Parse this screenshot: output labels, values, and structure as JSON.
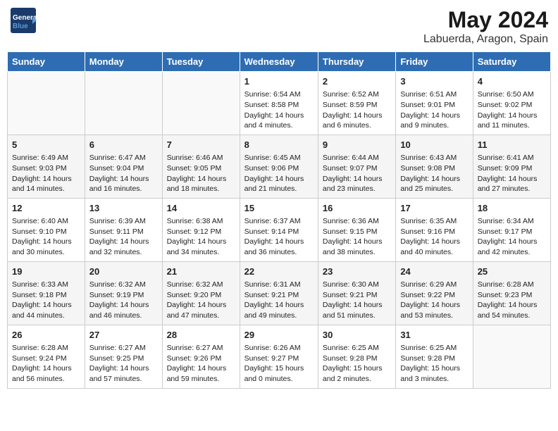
{
  "logo": {
    "line1": "General",
    "line2": "Blue"
  },
  "title": "May 2024",
  "subtitle": "Labuerda, Aragon, Spain",
  "days_header": [
    "Sunday",
    "Monday",
    "Tuesday",
    "Wednesday",
    "Thursday",
    "Friday",
    "Saturday"
  ],
  "weeks": [
    [
      {
        "day": "",
        "info": ""
      },
      {
        "day": "",
        "info": ""
      },
      {
        "day": "",
        "info": ""
      },
      {
        "day": "1",
        "info": "Sunrise: 6:54 AM\nSunset: 8:58 PM\nDaylight: 14 hours\nand 4 minutes."
      },
      {
        "day": "2",
        "info": "Sunrise: 6:52 AM\nSunset: 8:59 PM\nDaylight: 14 hours\nand 6 minutes."
      },
      {
        "day": "3",
        "info": "Sunrise: 6:51 AM\nSunset: 9:01 PM\nDaylight: 14 hours\nand 9 minutes."
      },
      {
        "day": "4",
        "info": "Sunrise: 6:50 AM\nSunset: 9:02 PM\nDaylight: 14 hours\nand 11 minutes."
      }
    ],
    [
      {
        "day": "5",
        "info": "Sunrise: 6:49 AM\nSunset: 9:03 PM\nDaylight: 14 hours\nand 14 minutes."
      },
      {
        "day": "6",
        "info": "Sunrise: 6:47 AM\nSunset: 9:04 PM\nDaylight: 14 hours\nand 16 minutes."
      },
      {
        "day": "7",
        "info": "Sunrise: 6:46 AM\nSunset: 9:05 PM\nDaylight: 14 hours\nand 18 minutes."
      },
      {
        "day": "8",
        "info": "Sunrise: 6:45 AM\nSunset: 9:06 PM\nDaylight: 14 hours\nand 21 minutes."
      },
      {
        "day": "9",
        "info": "Sunrise: 6:44 AM\nSunset: 9:07 PM\nDaylight: 14 hours\nand 23 minutes."
      },
      {
        "day": "10",
        "info": "Sunrise: 6:43 AM\nSunset: 9:08 PM\nDaylight: 14 hours\nand 25 minutes."
      },
      {
        "day": "11",
        "info": "Sunrise: 6:41 AM\nSunset: 9:09 PM\nDaylight: 14 hours\nand 27 minutes."
      }
    ],
    [
      {
        "day": "12",
        "info": "Sunrise: 6:40 AM\nSunset: 9:10 PM\nDaylight: 14 hours\nand 30 minutes."
      },
      {
        "day": "13",
        "info": "Sunrise: 6:39 AM\nSunset: 9:11 PM\nDaylight: 14 hours\nand 32 minutes."
      },
      {
        "day": "14",
        "info": "Sunrise: 6:38 AM\nSunset: 9:12 PM\nDaylight: 14 hours\nand 34 minutes."
      },
      {
        "day": "15",
        "info": "Sunrise: 6:37 AM\nSunset: 9:14 PM\nDaylight: 14 hours\nand 36 minutes."
      },
      {
        "day": "16",
        "info": "Sunrise: 6:36 AM\nSunset: 9:15 PM\nDaylight: 14 hours\nand 38 minutes."
      },
      {
        "day": "17",
        "info": "Sunrise: 6:35 AM\nSunset: 9:16 PM\nDaylight: 14 hours\nand 40 minutes."
      },
      {
        "day": "18",
        "info": "Sunrise: 6:34 AM\nSunset: 9:17 PM\nDaylight: 14 hours\nand 42 minutes."
      }
    ],
    [
      {
        "day": "19",
        "info": "Sunrise: 6:33 AM\nSunset: 9:18 PM\nDaylight: 14 hours\nand 44 minutes."
      },
      {
        "day": "20",
        "info": "Sunrise: 6:32 AM\nSunset: 9:19 PM\nDaylight: 14 hours\nand 46 minutes."
      },
      {
        "day": "21",
        "info": "Sunrise: 6:32 AM\nSunset: 9:20 PM\nDaylight: 14 hours\nand 47 minutes."
      },
      {
        "day": "22",
        "info": "Sunrise: 6:31 AM\nSunset: 9:21 PM\nDaylight: 14 hours\nand 49 minutes."
      },
      {
        "day": "23",
        "info": "Sunrise: 6:30 AM\nSunset: 9:21 PM\nDaylight: 14 hours\nand 51 minutes."
      },
      {
        "day": "24",
        "info": "Sunrise: 6:29 AM\nSunset: 9:22 PM\nDaylight: 14 hours\nand 53 minutes."
      },
      {
        "day": "25",
        "info": "Sunrise: 6:28 AM\nSunset: 9:23 PM\nDaylight: 14 hours\nand 54 minutes."
      }
    ],
    [
      {
        "day": "26",
        "info": "Sunrise: 6:28 AM\nSunset: 9:24 PM\nDaylight: 14 hours\nand 56 minutes."
      },
      {
        "day": "27",
        "info": "Sunrise: 6:27 AM\nSunset: 9:25 PM\nDaylight: 14 hours\nand 57 minutes."
      },
      {
        "day": "28",
        "info": "Sunrise: 6:27 AM\nSunset: 9:26 PM\nDaylight: 14 hours\nand 59 minutes."
      },
      {
        "day": "29",
        "info": "Sunrise: 6:26 AM\nSunset: 9:27 PM\nDaylight: 15 hours\nand 0 minutes."
      },
      {
        "day": "30",
        "info": "Sunrise: 6:25 AM\nSunset: 9:28 PM\nDaylight: 15 hours\nand 2 minutes."
      },
      {
        "day": "31",
        "info": "Sunrise: 6:25 AM\nSunset: 9:28 PM\nDaylight: 15 hours\nand 3 minutes."
      },
      {
        "day": "",
        "info": ""
      }
    ]
  ]
}
